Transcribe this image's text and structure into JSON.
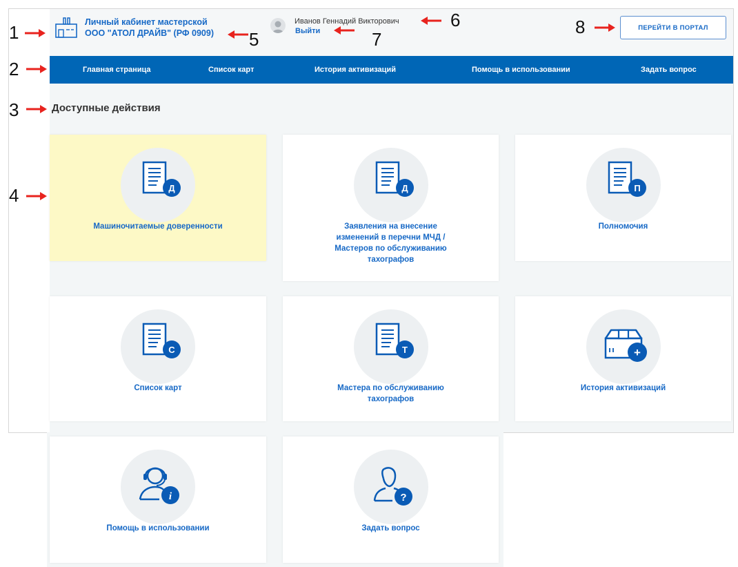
{
  "header": {
    "company_line1": "Личный кабинет мастерской",
    "company_line2": "ООО \"АТОЛ ДРАЙВ\" (РФ 0909)",
    "user_name": "Иванов Геннадий Викторович",
    "logout_label": "Выйти",
    "portal_button": "ПЕРЕЙТИ В ПОРТАЛ"
  },
  "nav": {
    "items": [
      {
        "label": "Главная страница"
      },
      {
        "label": "Список карт"
      },
      {
        "label": "История активизаций"
      },
      {
        "label": "Помощь в использовании"
      },
      {
        "label": "Задать вопрос"
      }
    ]
  },
  "section_title": "Доступные действия",
  "cards": [
    {
      "label": "Машиночитаемые доверенности",
      "badge": "Д",
      "icon": "document-icon"
    },
    {
      "label": "Заявления на внесение изменений в перечни МЧД / Мастеров по обслуживанию тахографов",
      "badge": "Д",
      "icon": "document-icon"
    },
    {
      "label": "Полномочия",
      "badge": "П",
      "icon": "document-icon"
    },
    {
      "label": "Список карт",
      "badge": "С",
      "icon": "document-icon"
    },
    {
      "label": "Мастера по обслуживанию тахографов",
      "badge": "Т",
      "icon": "document-icon"
    },
    {
      "label": "История активизаций",
      "badge": "+",
      "icon": "package-icon"
    },
    {
      "label": "Помощь в использовании",
      "badge": "i",
      "icon": "support-icon"
    },
    {
      "label": "Задать вопрос",
      "badge": "?",
      "icon": "user-question-icon"
    }
  ],
  "annotations": [
    "1",
    "2",
    "3",
    "4",
    "5",
    "6",
    "7",
    "8"
  ],
  "colors": {
    "accent": "#1769c6",
    "nav_bg": "#0066b6",
    "badge": "#0a5bb5",
    "active_card": "#fdf9c6",
    "arrow": "#e8231e"
  }
}
